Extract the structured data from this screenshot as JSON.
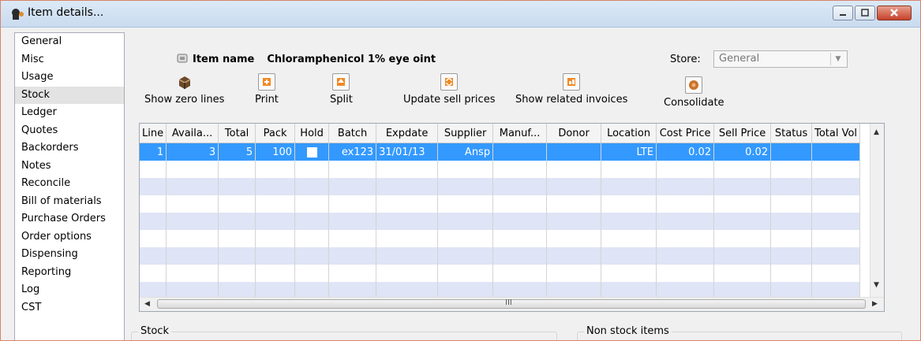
{
  "window": {
    "title": "Item details...",
    "colors": {
      "accent": "#3399ff",
      "alt_row": "#dfe4f6",
      "border": "#d9826b"
    }
  },
  "sidebar": {
    "items": [
      {
        "label": "General"
      },
      {
        "label": "Misc"
      },
      {
        "label": "Usage"
      },
      {
        "label": "Stock",
        "selected": true
      },
      {
        "label": "Ledger"
      },
      {
        "label": "Quotes"
      },
      {
        "label": "Backorders"
      },
      {
        "label": "Notes"
      },
      {
        "label": "Reconcile"
      },
      {
        "label": "Bill of materials"
      },
      {
        "label": "Purchase Orders"
      },
      {
        "label": "Order options"
      },
      {
        "label": "Dispensing"
      },
      {
        "label": "Reporting"
      },
      {
        "label": "Log"
      },
      {
        "label": "CST"
      }
    ]
  },
  "item": {
    "name_label": "Item name",
    "name_value": "Chloramphenicol 1% eye oint"
  },
  "store": {
    "label": "Store:",
    "value": "General"
  },
  "toolbar": {
    "show_zero_lines": "Show zero lines",
    "print": "Print",
    "split": "Split",
    "update_sell_prices": "Update sell prices",
    "show_related_invoices": "Show related invoices",
    "consolidate": "Consolidate"
  },
  "table": {
    "columns": [
      "Line",
      "Availa...",
      "Total",
      "Pack",
      "Hold",
      "Batch",
      "Expdate",
      "Supplier",
      "Manuf...",
      "Donor",
      "Location",
      "Cost Price",
      "Sell Price",
      "Status",
      "Total Vol"
    ],
    "rows": [
      {
        "line": "1",
        "available": "3",
        "total": "5",
        "pack": "100",
        "hold": false,
        "batch": "ex123",
        "expdate": "31/01/13",
        "supplier": "Ansp",
        "manuf": "",
        "donor": "",
        "location": "LTE",
        "cost_price": "0.02",
        "sell_price": "0.02",
        "status": "",
        "total_vol": ""
      }
    ],
    "scroll_grip": "III"
  },
  "sections": {
    "stock": "Stock",
    "non_stock": "Non stock items"
  }
}
